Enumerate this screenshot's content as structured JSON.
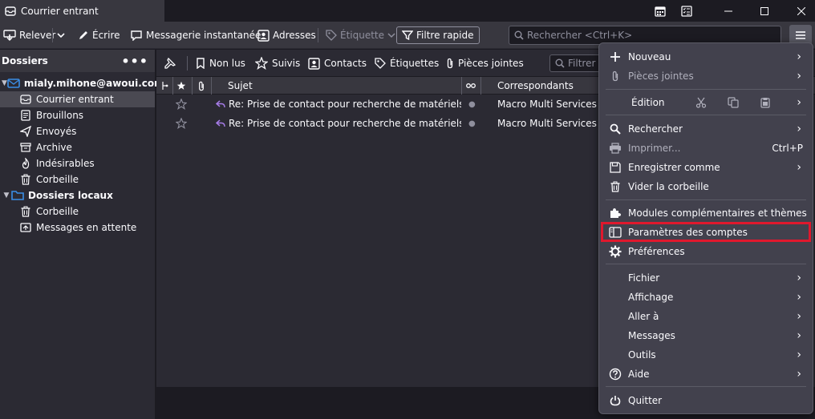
{
  "window": {
    "tab_title": "Courrier entrant"
  },
  "toolbar": {
    "get_messages": "Relever",
    "write": "Écrire",
    "chat": "Messagerie instantanée",
    "address_book": "Adresses",
    "tag": "Étiquette",
    "quick_filter": "Filtre rapide",
    "search_placeholder": "Rechercher <Ctrl+K>"
  },
  "folder_pane": {
    "header": "Dossiers",
    "account": "mialy.mihone@awoui.com",
    "account_folders": [
      "Courrier entrant",
      "Brouillons",
      "Envoyés",
      "Archive",
      "Indésirables",
      "Corbeille"
    ],
    "local_folders_label": "Dossiers locaux",
    "local_folders": [
      "Corbeille",
      "Messages en attente"
    ]
  },
  "quick_filter_bar": {
    "unread": "Non lus",
    "starred": "Suivis",
    "contacts": "Contacts",
    "tags": "Étiquettes",
    "attachments": "Pièces jointes",
    "filter_placeholder": "Filtrer c"
  },
  "columns": {
    "subject": "Sujet",
    "correspondents": "Correspondants"
  },
  "messages": [
    {
      "subject": "Re:  Prise de contact pour recherche de matériels et l...",
      "correspondent": "Macro Multi Services"
    },
    {
      "subject": "Re: Prise de contact pour recherche de matériels et lo...",
      "correspondent": "Macro Multi Services"
    }
  ],
  "app_menu": {
    "new": "Nouveau",
    "attachments": "Pièces jointes",
    "edit": "Édition",
    "find": "Rechercher",
    "print": "Imprimer...",
    "print_shortcut": "Ctrl+P",
    "save_as": "Enregistrer comme",
    "empty_trash": "Vider la corbeille",
    "addons": "Modules complémentaires et thèmes",
    "account_settings": "Paramètres des comptes",
    "preferences": "Préférences",
    "file": "Fichier",
    "view": "Affichage",
    "go": "Aller à",
    "messages": "Messages",
    "tools": "Outils",
    "help": "Aide",
    "quit": "Quitter"
  },
  "colors": {
    "highlight": "#e0182d",
    "accent_blue": "#3a8ee6",
    "reply_purple": "#a67ce8"
  }
}
